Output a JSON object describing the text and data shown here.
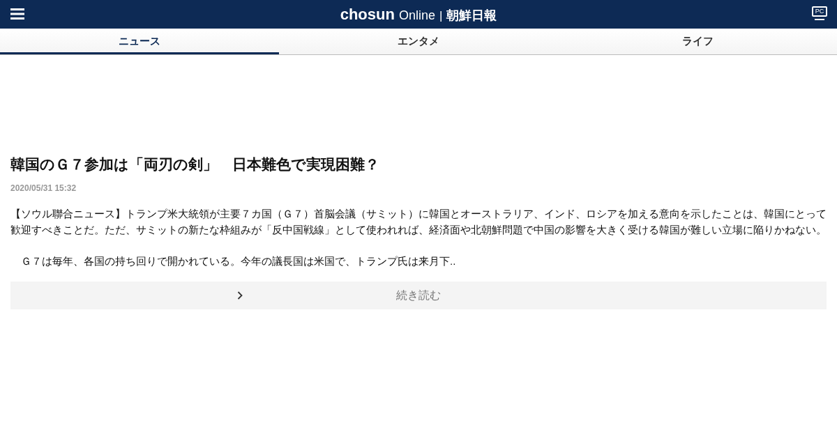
{
  "header": {
    "logo_latin": "chosun",
    "logo_online": "Online",
    "logo_divider": "|",
    "logo_kanji": "朝鮮日報",
    "pc_label": "PC"
  },
  "tabs": [
    {
      "label": "ニュース",
      "selected": true
    },
    {
      "label": "エンタメ",
      "selected": false
    },
    {
      "label": "ライフ",
      "selected": false
    }
  ],
  "article": {
    "title": "韓国のＧ７参加は「両刃の剣」　日本難色で実現困難？",
    "date": "2020/05/31 15:32",
    "paragraphs": [
      "【ソウル聯合ニュース】トランプ米大統領が主要７カ国（Ｇ７）首脳会議（サミット）に韓国とオーストラリア、インド、ロシアを加える意向を示したことは、韓国にとって歓迎すべきことだ。ただ、サミットの新たな枠組みが「反中国戦線」として使われれば、経済面や北朝鮮問題で中国の影響を大きく受ける韓国が難しい立場に陥りかねない。",
      "　Ｇ７は毎年、各国の持ち回りで開かれている。今年の議長国は米国で、トランプ氏は来月下.."
    ],
    "more_label": "続き読む"
  }
}
